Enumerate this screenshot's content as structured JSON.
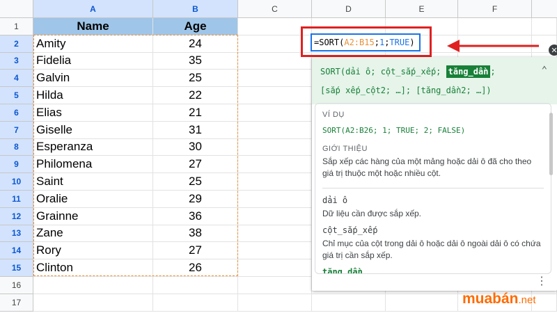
{
  "columns": [
    "A",
    "B",
    "C",
    "D",
    "E",
    "F"
  ],
  "rows": [
    "1",
    "2",
    "3",
    "4",
    "5",
    "6",
    "7",
    "8",
    "9",
    "10",
    "11",
    "12",
    "13",
    "14",
    "15",
    "16",
    "17"
  ],
  "table": {
    "headers": [
      "Name",
      "Age"
    ],
    "rows": [
      {
        "name": "Amity",
        "age": "24"
      },
      {
        "name": "Fidelia",
        "age": "35"
      },
      {
        "name": "Galvin",
        "age": "25"
      },
      {
        "name": "Hilda",
        "age": "22"
      },
      {
        "name": "Elias",
        "age": "21"
      },
      {
        "name": "Giselle",
        "age": "31"
      },
      {
        "name": "Esperanza",
        "age": "30"
      },
      {
        "name": "Philomena",
        "age": "27"
      },
      {
        "name": "Saint",
        "age": "25"
      },
      {
        "name": "Oralie",
        "age": "29"
      },
      {
        "name": "Grainne",
        "age": "36"
      },
      {
        "name": "Zane",
        "age": "38"
      },
      {
        "name": "Rory",
        "age": "27"
      },
      {
        "name": "Clinton",
        "age": "26"
      }
    ]
  },
  "formula": {
    "prefix": "=SORT(",
    "range": "A2:B15",
    "sep1": ";",
    "col": "1",
    "sep2": ";",
    "flag": "TRUE",
    "suffix": ")"
  },
  "help": {
    "signature_1a": "SORT(dải ô; cột_sắp_xếp; ",
    "signature_1b": "tăng_dần",
    "signature_1c": ";",
    "signature_2": "[sắp xếp_cột2; …]; [tăng_dần2; …])",
    "example_title": "VÍ DỤ",
    "example": "SORT(A2:B26; 1; TRUE; 2; FALSE)",
    "intro_title": "GIỚI THIỆU",
    "intro": "Sắp xếp các hàng của một mảng hoặc dải ô đã cho theo giá trị thuộc một hoặc nhiều cột.",
    "param1": "dải ô",
    "param1_desc": "Dữ liệu cần được sắp xếp.",
    "param2": "cột_sắp_xếp",
    "param2_desc": "Chỉ mục của cột trong dải ô hoặc dải ô ngoài dải ô có chứa giá trị cần sắp xếp.",
    "param3": "tăng_dần"
  },
  "watermark": {
    "main": "muabán",
    "suffix": ".net"
  },
  "colors": {
    "header_fill": "#9fc5e8",
    "highlight_red": "#e02020",
    "formula_green": "#188038",
    "accent_blue": "#1a73e8"
  }
}
